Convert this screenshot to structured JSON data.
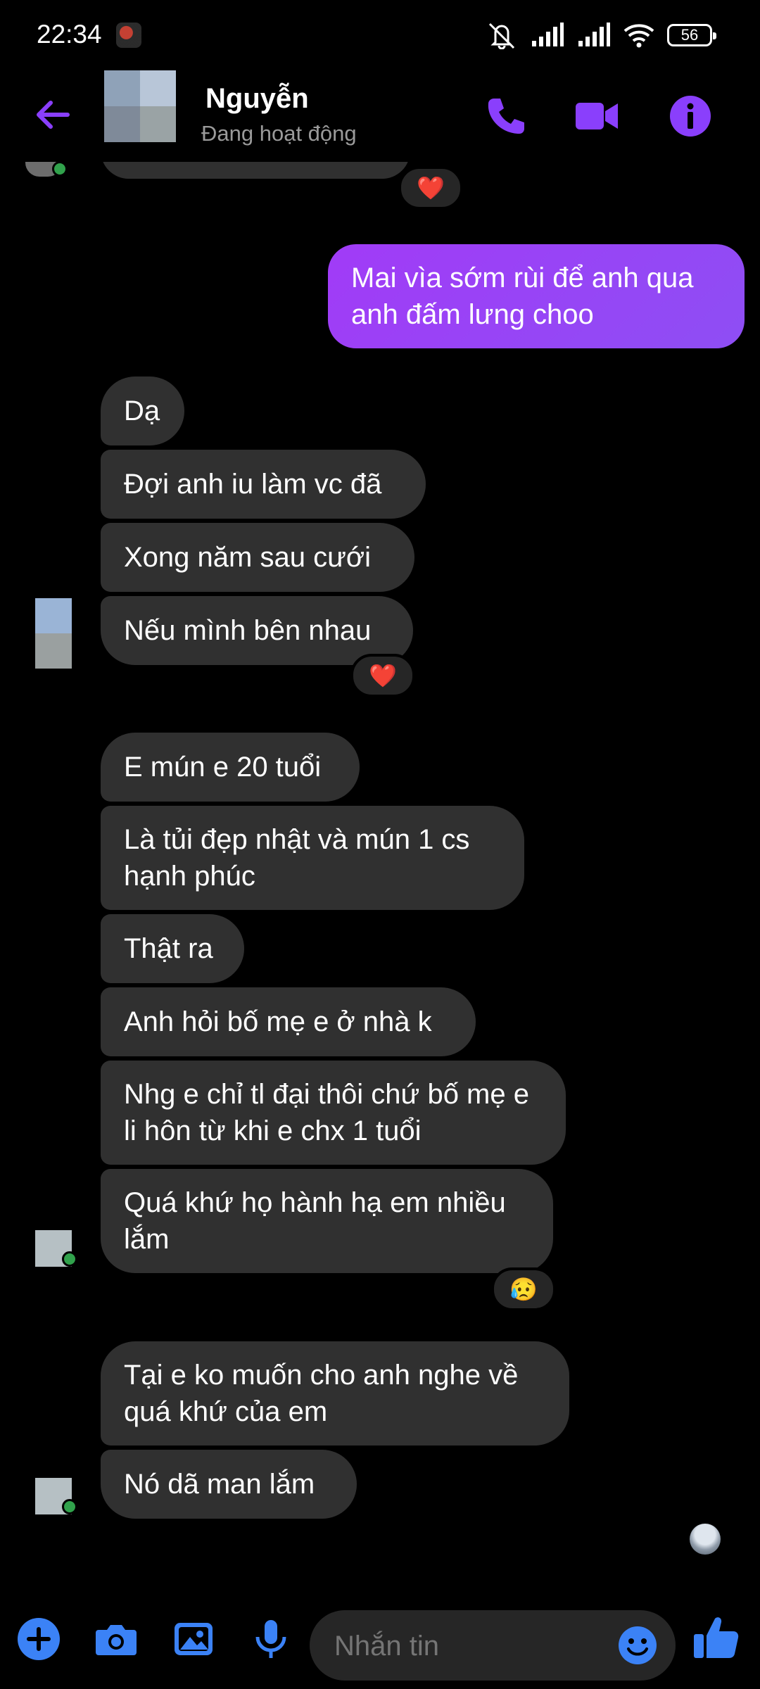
{
  "status_bar": {
    "time": "22:34",
    "battery": "56"
  },
  "header": {
    "contact_name": "Nguyễn",
    "contact_status": "Đang hoạt động"
  },
  "messages": [
    {
      "dir": "out",
      "text": "Mai vìa sớm rùi để anh qua anh đấm lưng choo"
    },
    {
      "dir": "in",
      "text": "Dạ"
    },
    {
      "dir": "in",
      "text": "Đợi anh iu làm vc đã"
    },
    {
      "dir": "in",
      "text": "Xong năm sau cưới"
    },
    {
      "dir": "in",
      "text": "Nếu mình bên nhau",
      "reaction": "❤️"
    },
    {
      "dir": "in",
      "text": "E mún e 20 tuổi"
    },
    {
      "dir": "in",
      "text": "Là tủi đẹp nhật và mún 1 cs hạnh phúc"
    },
    {
      "dir": "in",
      "text": "Thật ra"
    },
    {
      "dir": "in",
      "text": "Anh hỏi bố mẹ e ở nhà k"
    },
    {
      "dir": "in",
      "text": "Nhg e chỉ tl đại thôi chứ bố mẹ e li hôn từ khi e chx 1 tuổi"
    },
    {
      "dir": "in",
      "text": "Quá khứ họ hành hạ em nhiều lắm",
      "reaction": "😥"
    },
    {
      "dir": "in",
      "text": "Tại e ko muốn cho anh nghe về quá khứ của em"
    },
    {
      "dir": "in",
      "text": "Nó dã man lắm"
    }
  ],
  "top_reaction": "❤️",
  "composer": {
    "placeholder": "Nhắn tin"
  },
  "colors": {
    "accent": "#8a3ffc",
    "incoming_bubble": "#303030",
    "outgoing_bubble": "#9b44f6",
    "composer_icons": "#3b82f6"
  },
  "icons": [
    "back-arrow-icon",
    "phone-icon",
    "video-camera-icon",
    "info-icon",
    "plus-icon",
    "camera-icon",
    "gallery-icon",
    "microphone-icon",
    "emoji-icon",
    "thumbs-up-icon"
  ]
}
